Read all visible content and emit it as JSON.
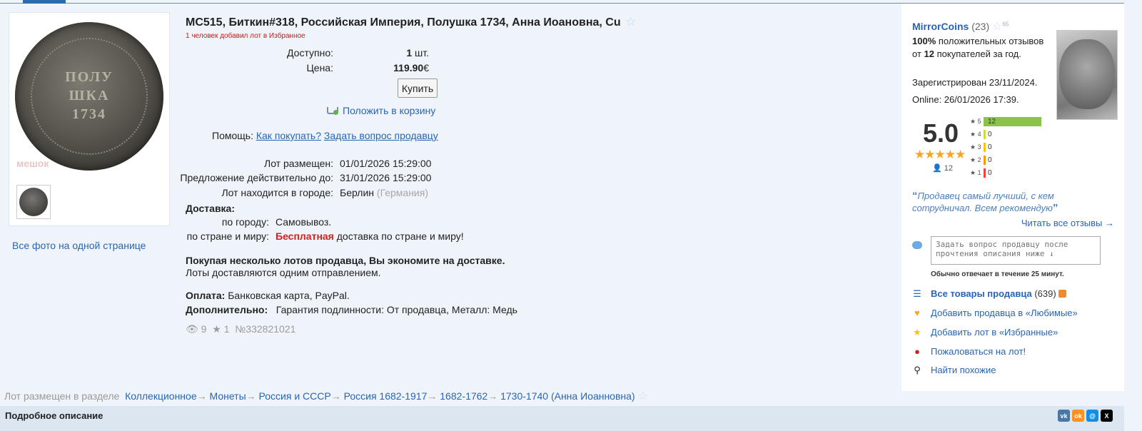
{
  "lot": {
    "title": "MC515, Биткин#318, Российская Империя, Полушка 1734, Анна Иоановна, Cu",
    "favorites_note": "1 человек добавил лот в Избранное",
    "available_label": "Доступно:",
    "available_value": "1",
    "available_unit": " шт.",
    "price_label": "Цена:",
    "price_value": "119.90",
    "price_currency": "€",
    "buy_label": "Купить",
    "cart_label": "Положить в корзину",
    "help_label": "Помощь:",
    "help_how": "Как покупать?",
    "help_ask": "Задать вопрос продавцу",
    "placed_label": "Лот размещен:",
    "placed_value": "01/01/2026 15:29:00",
    "valid_label": "Предложение действительно до:",
    "valid_value": "31/01/2026 15:29:00",
    "city_label": "Лот находится в городе:",
    "city_value": "Берлин",
    "country_value": "(Германия)",
    "delivery_heading": "Доставка:",
    "delivery_city_label": "по городу:",
    "delivery_city_value": "Самовывоз.",
    "delivery_world_label": "по стране и миру:",
    "delivery_world_free": "Бесплатная",
    "delivery_world_rest": " доставка по стране и миру!",
    "multi_bold": "Покупая несколько лотов продавца, Вы экономите на доставке.",
    "multi_text": "Лоты доставляются одним отправлением.",
    "payment_label": "Оплата:",
    "payment_value": " Банковская карта, PayPal.",
    "extra_label": "Дополнительно:",
    "extra_value": "Гарантия подлинности: От продавца, Металл: Медь",
    "views": "9",
    "favs": "1",
    "lot_number": "№332821021"
  },
  "photos": {
    "coin_line1": "ПОЛУ",
    "coin_line2": "ШКА",
    "coin_line3": "1734",
    "watermark": "мешок",
    "all_photos_label": "Все фото на одной странице"
  },
  "seller": {
    "name": "MirrorCoins",
    "count": "(23)",
    "star_sup": "65",
    "positive_pct": "100%",
    "positive_text": " положительных отзывов от ",
    "positive_buyers": "12",
    "positive_tail": " покупателей за год.",
    "registered": "Зарегистрирован 23/11/2024.",
    "online": "Online: 26/01/2026 17:39.",
    "rating": "5.0",
    "rating_people": "12",
    "rating_bars": [
      {
        "stars": "5",
        "count": 12,
        "fraction": 1.0,
        "color": "#8bc34a"
      },
      {
        "stars": "4",
        "count": 0,
        "fraction": 0.0,
        "color": "#cddc39"
      },
      {
        "stars": "3",
        "count": 0,
        "fraction": 0.0,
        "color": "#ffc107"
      },
      {
        "stars": "2",
        "count": 0,
        "fraction": 0.0,
        "color": "#ff9800"
      },
      {
        "stars": "1",
        "count": 0,
        "fraction": 0.0,
        "color": "#f44336"
      }
    ],
    "quote": "Продавец самый лучший, с кем сотрудничал. Всем рекомендую",
    "read_all": "Читать все отзывы →",
    "ask_placeholder": "Задать вопрос продавцу после прочтения описания ниже ↓",
    "response_note": "Обычно отвечает в течение 25 минут.",
    "all_goods": "Все товары продавца",
    "all_goods_count": "(639)",
    "add_fav_seller": "Добавить продавца в «Любимые»",
    "add_fav_lot": "Добавить лот в «Избранные»",
    "complain": "Пожаловаться на лот!",
    "find_similar": "Найти похожие"
  },
  "breadcrumb": {
    "prefix": "Лот размещен в разделе",
    "items": [
      "Коллекционное",
      "Монеты",
      "Россия и СССР",
      "Россия 1682-1917",
      "1682-1762",
      "1730-1740 (Анна Иоанновна)"
    ]
  },
  "description": {
    "title": "Подробное описание"
  },
  "share": [
    {
      "icon": "vk-icon",
      "label": "vk",
      "color": "#4a76a8"
    },
    {
      "icon": "ok-icon",
      "label": "ok",
      "color": "#f7931e"
    },
    {
      "icon": "mailru-icon",
      "label": "@",
      "color": "#168de2"
    },
    {
      "icon": "x-icon",
      "label": "X",
      "color": "#000000"
    }
  ]
}
